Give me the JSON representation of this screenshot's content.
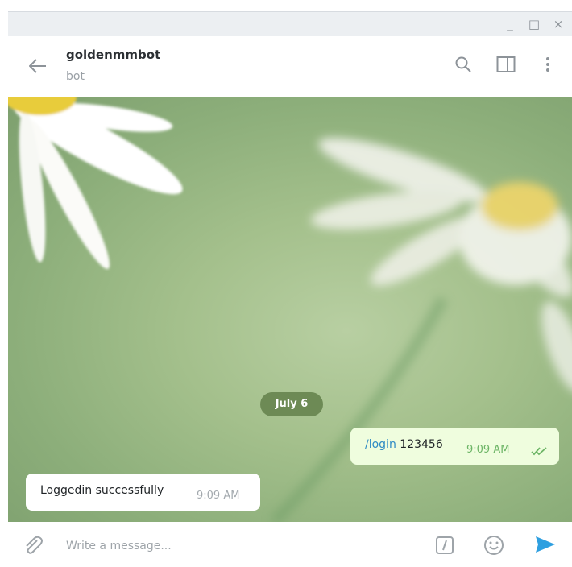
{
  "window": {
    "controls": [
      "_",
      "□",
      "×"
    ]
  },
  "header": {
    "chat_name": "goldenmmbot",
    "subtitle": "bot",
    "icons": [
      "back-arrow-icon",
      "search-icon",
      "sidebar-panel-icon",
      "more-vertical-icon"
    ]
  },
  "chat": {
    "date_label": "July 6",
    "messages": [
      {
        "direction": "outgoing",
        "command": "/login",
        "text": "123456",
        "time": "9:09 AM",
        "status": "read-double-check"
      },
      {
        "direction": "incoming",
        "text": "Loggedin successfully",
        "time": "9:09 AM"
      }
    ]
  },
  "composer": {
    "placeholder": "Write a message...",
    "icons": [
      "attach-icon",
      "bot-command-icon",
      "emoji-icon",
      "send-icon"
    ]
  },
  "colors": {
    "accent": "#2e8bc4",
    "outgoing_bubble": "#effdde",
    "outgoing_time": "#6db566",
    "date_pill": "#6d8a55"
  }
}
